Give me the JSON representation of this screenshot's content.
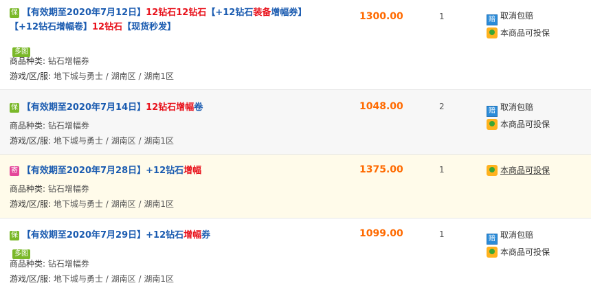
{
  "items": [
    {
      "badge": "保",
      "title_parts": [
        {
          "text": "【有效期至2020年7月12日】",
          "hl": false
        },
        {
          "text": "12钻石12钻石",
          "hl": true
        },
        {
          "text": "【+12钻石",
          "hl": false
        },
        {
          "text": "装备",
          "hl": true
        },
        {
          "text": "增幅券】",
          "hl": false
        }
      ],
      "title_line2": [
        {
          "text": "【+12钻石增幅卷】",
          "hl": false
        },
        {
          "text": "12钻石",
          "hl": true
        },
        {
          "text": "【现货秒发】",
          "hl": false
        }
      ],
      "tag": "多图",
      "category_label": "商品种类:",
      "category_value": "钻石增幅券",
      "server_label": "游戏/区/服:",
      "server_value": "地下城与勇士 / 湖南区 / 湖南1区",
      "price": "1300.00",
      "qty": "1",
      "svc_cancel": "取消包赔",
      "svc_insure": "本商品可投保"
    },
    {
      "badge": "保",
      "title_parts": [
        {
          "text": "【有效期至2020年7月14日】",
          "hl": false
        },
        {
          "text": "12钻石增幅",
          "hl": true
        },
        {
          "text": "卷",
          "hl": false
        }
      ],
      "category_label": "商品种类:",
      "category_value": "钻石增幅券",
      "server_label": "游戏/区/服:",
      "server_value": "地下城与勇士 / 湖南区 / 湖南1区",
      "price": "1048.00",
      "qty": "2",
      "svc_cancel": "取消包赔",
      "svc_insure": "本商品可投保"
    },
    {
      "badge": "寄",
      "title_parts": [
        {
          "text": "【有效期至2020年7月28日】",
          "hl": false
        },
        {
          "text": "+12钻石",
          "hl": false
        },
        {
          "text": "增幅",
          "hl": true
        }
      ],
      "category_label": "商品种类:",
      "category_value": "钻石增幅券",
      "server_label": "游戏/区/服:",
      "server_value": "地下城与勇士 / 湖南区 / 湖南1区",
      "price": "1375.00",
      "qty": "1",
      "svc_insure": "本商品可投保"
    },
    {
      "badge": "保",
      "title_parts": [
        {
          "text": "【有效期至2020年7月29日】",
          "hl": false
        },
        {
          "text": "+12钻石",
          "hl": false
        },
        {
          "text": "增幅",
          "hl": true
        },
        {
          "text": "券",
          "hl": false
        }
      ],
      "tag": "多图",
      "category_label": "商品种类:",
      "category_value": "钻石增幅券",
      "server_label": "游戏/区/服:",
      "server_value": "地下城与勇士 / 湖南区 / 湖南1区",
      "price": "1099.00",
      "qty": "1",
      "svc_cancel": "取消包赔",
      "svc_insure": "本商品可投保"
    }
  ],
  "colors": {
    "title_blue": "#1a5bb0",
    "title_red": "#e8101a",
    "price_orange": "#ff6a00",
    "badge_green": "#7ab829",
    "badge_pink": "#e4479a"
  }
}
